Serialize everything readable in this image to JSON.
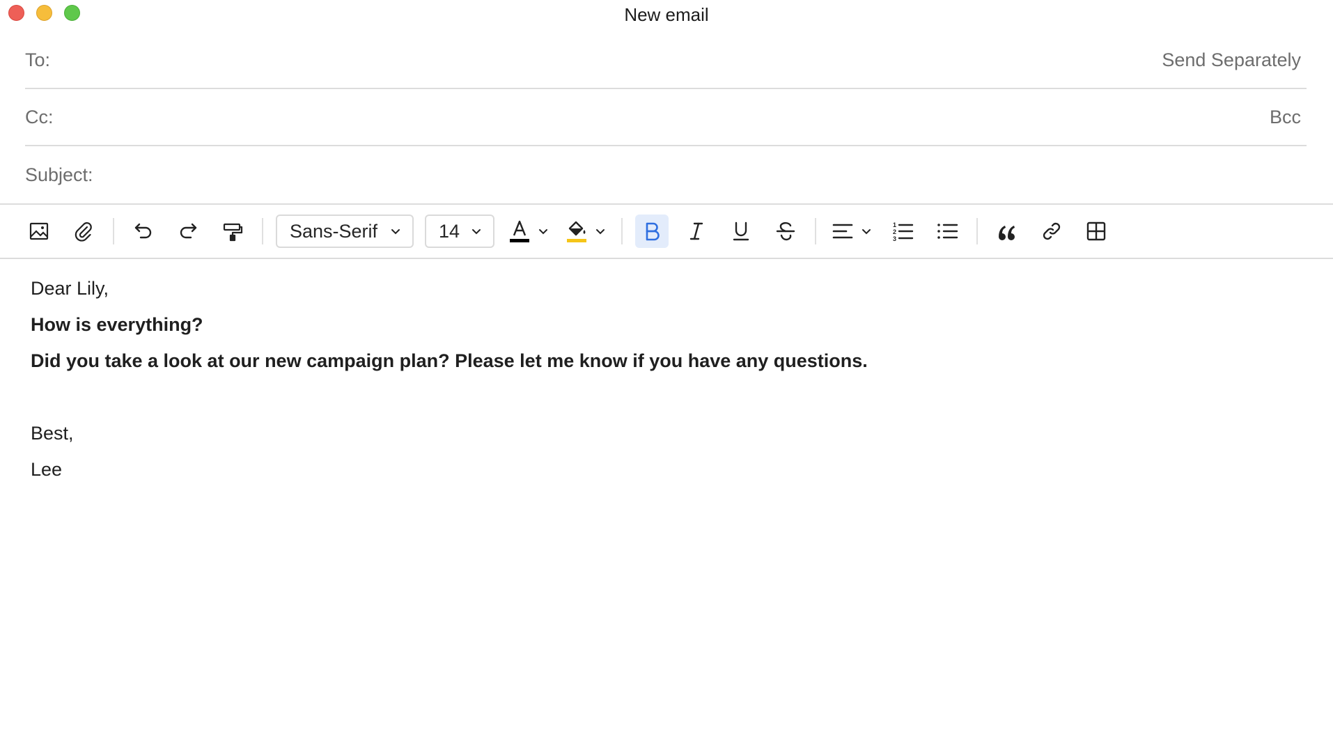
{
  "window": {
    "title": "New email"
  },
  "fields": {
    "to": {
      "label": "To:",
      "value": "",
      "action": "Send Separately"
    },
    "cc": {
      "label": "Cc:",
      "value": "",
      "action": "Bcc"
    },
    "subject": {
      "label": "Subject:",
      "value": ""
    }
  },
  "toolbar": {
    "font_family": "Sans-Serif",
    "font_size": "14",
    "text_color": "#000000",
    "highlight_color": "#f5c518",
    "active_color": "#2f6fe0",
    "buttons": [
      "image-icon",
      "attachment-icon",
      "undo-icon",
      "redo-icon",
      "format-painter-icon",
      "text-color-icon",
      "highlight-icon",
      "bold-icon",
      "italic-icon",
      "underline-icon",
      "strikethrough-icon",
      "align-icon",
      "numbered-list-icon",
      "bullet-list-icon",
      "quote-icon",
      "link-icon",
      "table-icon"
    ],
    "bold_active": true
  },
  "body": {
    "greeting": "Dear Lily,",
    "line1": "How is everything?",
    "line2": "Did you take a look at our new campaign plan? Please let me know if you have any questions.",
    "closing": "Best,",
    "signature": "Lee"
  }
}
